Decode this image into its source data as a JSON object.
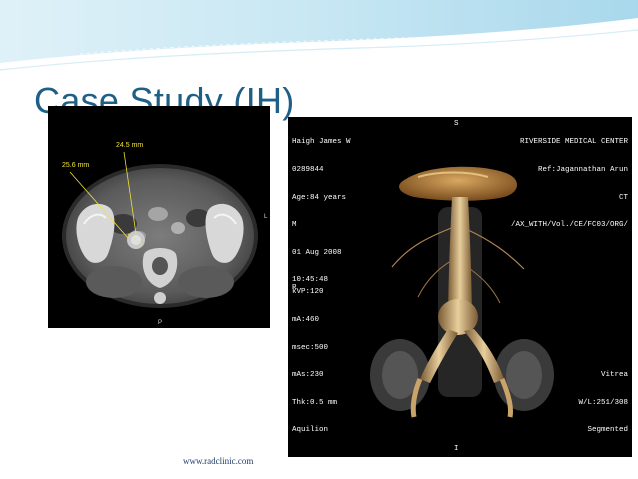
{
  "slide": {
    "title": "Case Study (IH)",
    "footer": "www.radclinic.com",
    "colors": {
      "title": "#1f5f86",
      "banner": "#bfe3f1"
    }
  },
  "ct_image": {
    "measure_1": "24.5 mm",
    "measure_2": "25.6 mm",
    "label_left": "L",
    "label_bottom": "P"
  },
  "angio_image": {
    "top_left": [
      "Haigh James W",
      "0289844",
      "Age:84 years",
      "M",
      "01 Aug 2008",
      "10:45:48"
    ],
    "top_right": [
      "RIVERSIDE MEDICAL CENTER",
      "Ref:Jagannathan Arun",
      "CT",
      "/AX_WITH/Vol./CE/FC03/ORG/"
    ],
    "bottom_left": [
      "kVP:120",
      "mA:460",
      "msec:500",
      "mAs:230",
      "Thk:0.5 mm",
      "Aquilion"
    ],
    "bottom_right": [
      "Vitrea",
      "W/L:251/308",
      "Segmented"
    ],
    "orient_top": "S",
    "orient_left": "R",
    "orient_bottom": "I"
  }
}
